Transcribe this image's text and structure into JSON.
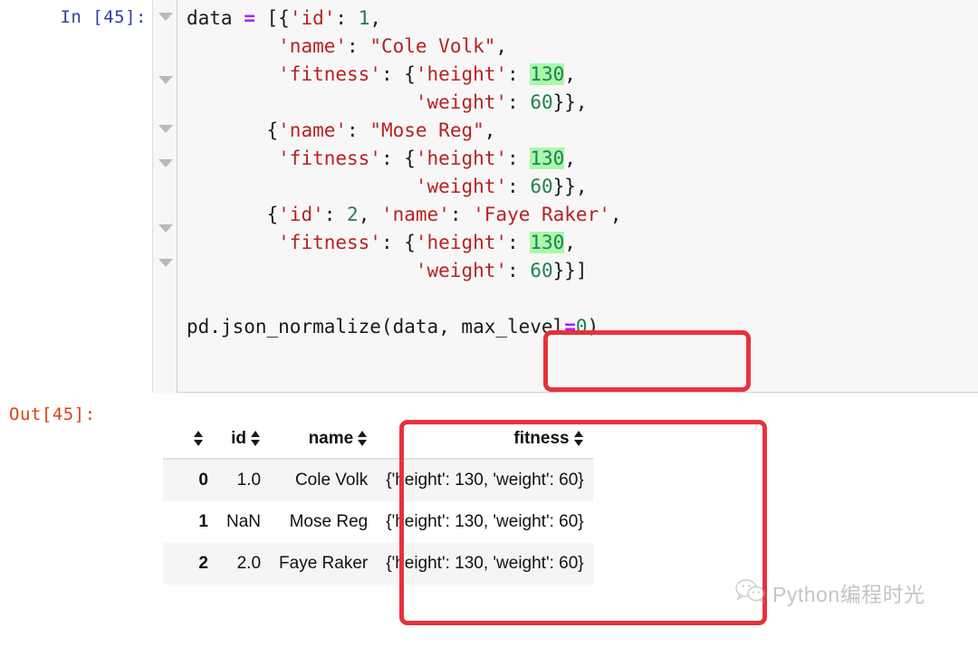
{
  "cell": {
    "in_prompt": "In [45]:",
    "out_prompt": "Out[45]:",
    "collapse_icon": "chevron-down-icon",
    "code_lines": [
      {
        "n": 0,
        "tokens": [
          {
            "t": "data ",
            "c": "plain"
          },
          {
            "t": "=",
            "c": "op"
          },
          {
            "t": " [{",
            "c": "plain"
          },
          {
            "t": "'id'",
            "c": "str"
          },
          {
            "t": ": ",
            "c": "plain"
          },
          {
            "t": "1",
            "c": "num"
          },
          {
            "t": ",",
            "c": "plain"
          }
        ]
      },
      {
        "n": 1,
        "tokens": [
          {
            "t": "        ",
            "c": "plain"
          },
          {
            "t": "'name'",
            "c": "str"
          },
          {
            "t": ": ",
            "c": "plain"
          },
          {
            "t": "\"Cole Volk\"",
            "c": "str"
          },
          {
            "t": ",",
            "c": "plain"
          }
        ]
      },
      {
        "n": 2,
        "tokens": [
          {
            "t": "        ",
            "c": "plain"
          },
          {
            "t": "'fitness'",
            "c": "str"
          },
          {
            "t": ": {",
            "c": "plain"
          },
          {
            "t": "'height'",
            "c": "str"
          },
          {
            "t": ": ",
            "c": "plain"
          },
          {
            "t": "130",
            "c": "num",
            "hl": true
          },
          {
            "t": ",",
            "c": "plain"
          }
        ]
      },
      {
        "n": 3,
        "tokens": [
          {
            "t": "                    ",
            "c": "plain"
          },
          {
            "t": "'weight'",
            "c": "str"
          },
          {
            "t": ": ",
            "c": "plain"
          },
          {
            "t": "60",
            "c": "num"
          },
          {
            "t": "}},",
            "c": "plain"
          }
        ]
      },
      {
        "n": 4,
        "tokens": [
          {
            "t": "       {",
            "c": "plain"
          },
          {
            "t": "'name'",
            "c": "str"
          },
          {
            "t": ": ",
            "c": "plain"
          },
          {
            "t": "\"Mose Reg\"",
            "c": "str"
          },
          {
            "t": ",",
            "c": "plain"
          }
        ]
      },
      {
        "n": 5,
        "tokens": [
          {
            "t": "        ",
            "c": "plain"
          },
          {
            "t": "'fitness'",
            "c": "str"
          },
          {
            "t": ": {",
            "c": "plain"
          },
          {
            "t": "'height'",
            "c": "str"
          },
          {
            "t": ": ",
            "c": "plain"
          },
          {
            "t": "130",
            "c": "num",
            "hl": true
          },
          {
            "t": ",",
            "c": "plain"
          }
        ]
      },
      {
        "n": 6,
        "tokens": [
          {
            "t": "                    ",
            "c": "plain"
          },
          {
            "t": "'weight'",
            "c": "str"
          },
          {
            "t": ": ",
            "c": "plain"
          },
          {
            "t": "60",
            "c": "num"
          },
          {
            "t": "}},",
            "c": "plain"
          }
        ]
      },
      {
        "n": 7,
        "tokens": [
          {
            "t": "       {",
            "c": "plain"
          },
          {
            "t": "'id'",
            "c": "str"
          },
          {
            "t": ": ",
            "c": "plain"
          },
          {
            "t": "2",
            "c": "num"
          },
          {
            "t": ", ",
            "c": "plain"
          },
          {
            "t": "'name'",
            "c": "str"
          },
          {
            "t": ": ",
            "c": "plain"
          },
          {
            "t": "'Faye Raker'",
            "c": "str"
          },
          {
            "t": ",",
            "c": "plain"
          }
        ]
      },
      {
        "n": 8,
        "tokens": [
          {
            "t": "        ",
            "c": "plain"
          },
          {
            "t": "'fitness'",
            "c": "str"
          },
          {
            "t": ": {",
            "c": "plain"
          },
          {
            "t": "'height'",
            "c": "str"
          },
          {
            "t": ": ",
            "c": "plain"
          },
          {
            "t": "130",
            "c": "num",
            "hl": true
          },
          {
            "t": ",",
            "c": "plain"
          }
        ]
      },
      {
        "n": 9,
        "tokens": [
          {
            "t": "                    ",
            "c": "plain"
          },
          {
            "t": "'weight'",
            "c": "str"
          },
          {
            "t": ": ",
            "c": "plain"
          },
          {
            "t": "60",
            "c": "num"
          },
          {
            "t": "}}]",
            "c": "plain"
          }
        ]
      },
      {
        "n": 10,
        "tokens": []
      },
      {
        "n": 11,
        "tokens": [
          {
            "t": "pd.json_normalize(data, max_level",
            "c": "plain"
          },
          {
            "t": "=",
            "c": "op"
          },
          {
            "t": "0",
            "c": "num"
          },
          {
            "t": ")",
            "c": "plain"
          }
        ]
      }
    ],
    "collapse_marker_tops": [
      14,
      84,
      138,
      176,
      248,
      286
    ]
  },
  "output_table": {
    "sort_icon": "sort-updown-icon",
    "columns": [
      "",
      "id",
      "name",
      "fitness"
    ],
    "rows": [
      {
        "index": "0",
        "id": "1.0",
        "name": "Cole Volk",
        "fitness": "{'height': 130, 'weight': 60}"
      },
      {
        "index": "1",
        "id": "NaN",
        "name": "Mose Reg",
        "fitness": "{'height': 130, 'weight': 60}"
      },
      {
        "index": "2",
        "id": "2.0",
        "name": "Faye Raker",
        "fitness": "{'height': 130, 'weight': 60}"
      }
    ]
  },
  "annotations": [
    {
      "name": "max-level-highlight",
      "color": "#E8323C",
      "target": "max_level=0)"
    },
    {
      "name": "fitness-column-highlight",
      "color": "#E8323C",
      "target": "fitness"
    }
  ],
  "watermark": {
    "icon": "wechat-logo-icon",
    "text": "Python编程时光"
  },
  "colors": {
    "string": "#BA2121",
    "number": "#208050",
    "operator": "#AA22FF",
    "in_prompt": "#303F9F",
    "out_prompt": "#D84315",
    "search_highlight": "#AAF7AA",
    "annotation_red": "#E8323C",
    "cell_background": "#f7f7f7"
  }
}
